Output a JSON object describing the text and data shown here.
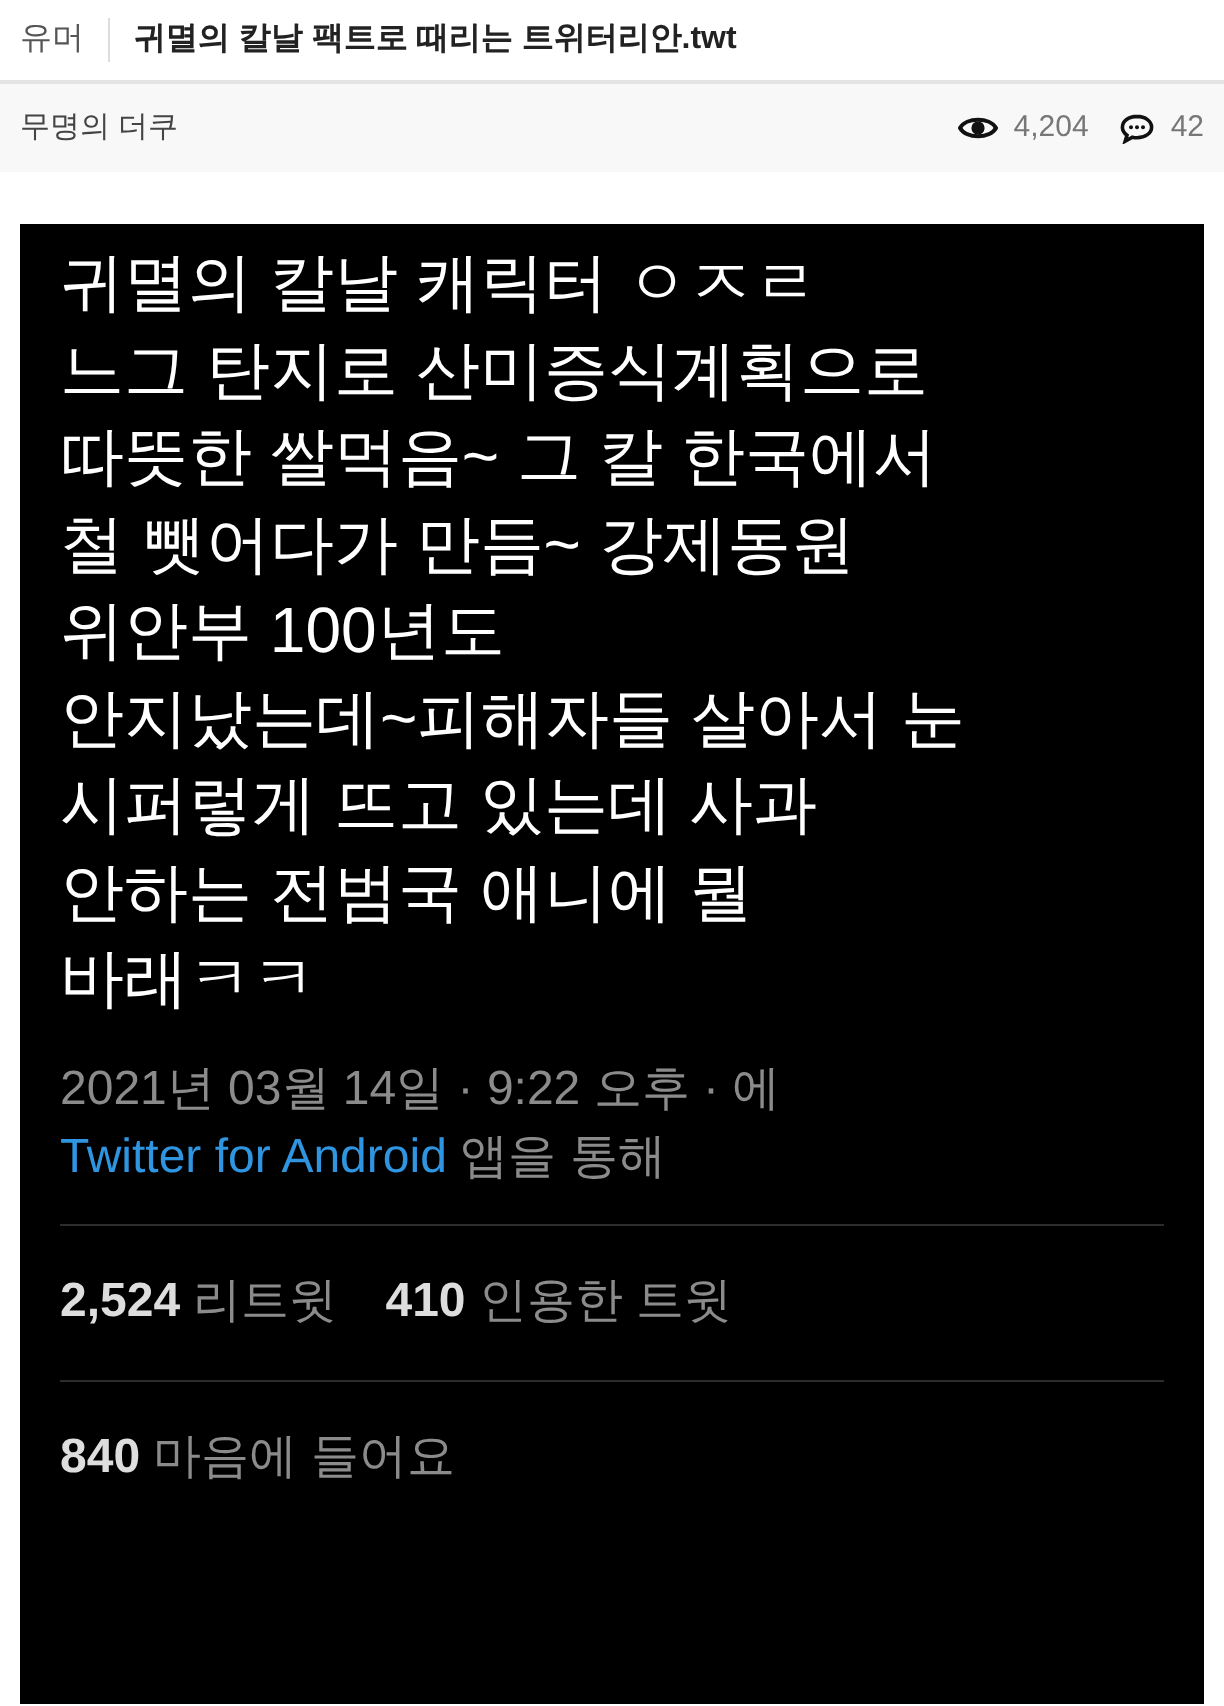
{
  "header": {
    "category": "유머",
    "title": "귀멸의 칼날 팩트로 때리는 트위터리안.twt"
  },
  "meta": {
    "author": "무명의 더쿠",
    "views": "4,204",
    "comments": "42"
  },
  "tweet": {
    "lines": [
      "귀멸의 칼날 캐릭터 ㅇㅈㄹ",
      "느그 탄지로 산미증식계획으로",
      "따뜻한 쌀먹음~ 그 칼 한국에서",
      "철 뺏어다가 만듬~  강제동원",
      "위안부 100년도",
      "안지났는데~피해자들 살아서 눈",
      "시퍼렇게 뜨고 있는데 사과",
      "안하는 전범국 애니에 뭘",
      "바래ㅋㅋ"
    ],
    "timestamp": "2021년 03월 14일 · 9:22 오후 · 에",
    "source_link": "Twitter for Android",
    "source_suffix": "앱을 통해",
    "stats": [
      {
        "count": "2,524",
        "label": "리트윗"
      },
      {
        "count": "410",
        "label": "인용한 트윗"
      }
    ],
    "likes": {
      "count": "840",
      "label": "마음에 들어요"
    }
  }
}
